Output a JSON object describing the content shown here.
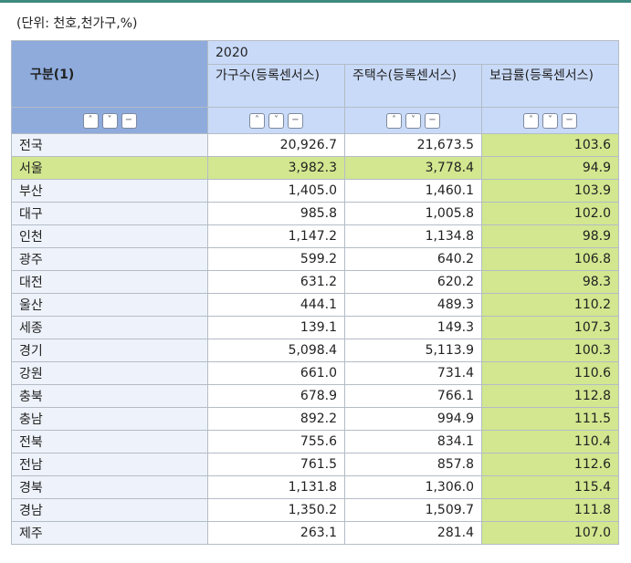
{
  "unit": "(단위: 천호,천가구,%)",
  "header": {
    "category": "구분(1)",
    "year": "2020",
    "cols": [
      "가구수(등록센서스)",
      "주택수(등록센서스)",
      "보급률(등록센서스)"
    ]
  },
  "controls": {
    "up": "˄",
    "down": "˅",
    "minus": "−"
  },
  "colors": {
    "header_dark": "#8eabdc",
    "header_light": "#c9daf8",
    "highlight": "#d2e78f"
  },
  "rows": [
    {
      "name": "전국",
      "v": [
        "20,926.7",
        "21,673.5",
        "103.6"
      ]
    },
    {
      "name": "서울",
      "v": [
        "3,982.3",
        "3,778.4",
        "94.9"
      ]
    },
    {
      "name": "부산",
      "v": [
        "1,405.0",
        "1,460.1",
        "103.9"
      ]
    },
    {
      "name": "대구",
      "v": [
        "985.8",
        "1,005.8",
        "102.0"
      ]
    },
    {
      "name": "인천",
      "v": [
        "1,147.2",
        "1,134.8",
        "98.9"
      ]
    },
    {
      "name": "광주",
      "v": [
        "599.2",
        "640.2",
        "106.8"
      ]
    },
    {
      "name": "대전",
      "v": [
        "631.2",
        "620.2",
        "98.3"
      ]
    },
    {
      "name": "울산",
      "v": [
        "444.1",
        "489.3",
        "110.2"
      ]
    },
    {
      "name": "세종",
      "v": [
        "139.1",
        "149.3",
        "107.3"
      ]
    },
    {
      "name": "경기",
      "v": [
        "5,098.4",
        "5,113.9",
        "100.3"
      ]
    },
    {
      "name": "강원",
      "v": [
        "661.0",
        "731.4",
        "110.6"
      ]
    },
    {
      "name": "충북",
      "v": [
        "678.9",
        "766.1",
        "112.8"
      ]
    },
    {
      "name": "충남",
      "v": [
        "892.2",
        "994.9",
        "111.5"
      ]
    },
    {
      "name": "전북",
      "v": [
        "755.6",
        "834.1",
        "110.4"
      ]
    },
    {
      "name": "전남",
      "v": [
        "761.5",
        "857.8",
        "112.6"
      ]
    },
    {
      "name": "경북",
      "v": [
        "1,131.8",
        "1,306.0",
        "115.4"
      ]
    },
    {
      "name": "경남",
      "v": [
        "1,350.2",
        "1,509.7",
        "111.8"
      ]
    },
    {
      "name": "제주",
      "v": [
        "263.1",
        "281.4",
        "107.0"
      ]
    }
  ]
}
